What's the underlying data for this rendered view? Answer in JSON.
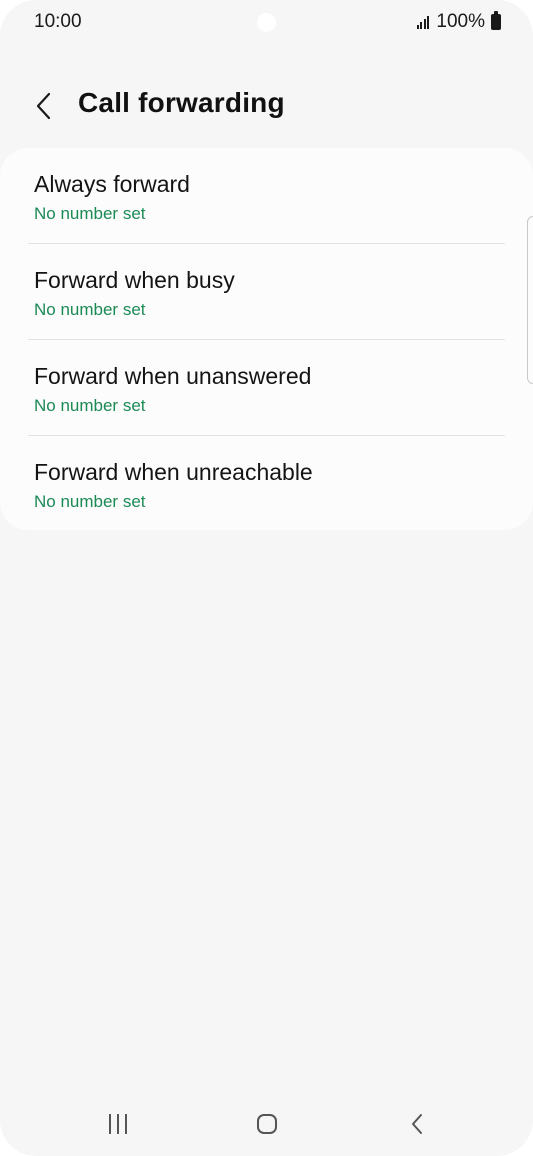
{
  "status_bar": {
    "time": "10:00",
    "battery": "100%"
  },
  "header": {
    "title": "Call forwarding",
    "back_icon": "chevron-left-icon"
  },
  "items": [
    {
      "title": "Always forward",
      "subtitle": "No number set"
    },
    {
      "title": "Forward when busy",
      "subtitle": "No number set"
    },
    {
      "title": "Forward when unanswered",
      "subtitle": "No number set"
    },
    {
      "title": "Forward when unreachable",
      "subtitle": "No number set"
    }
  ],
  "colors": {
    "accent": "#1b8a55",
    "background": "#f6f6f6",
    "card": "#fcfcfc"
  },
  "nav_bar": {
    "recents_icon": "recents-icon",
    "home_icon": "home-icon",
    "back_icon": "back-chevron-icon"
  }
}
